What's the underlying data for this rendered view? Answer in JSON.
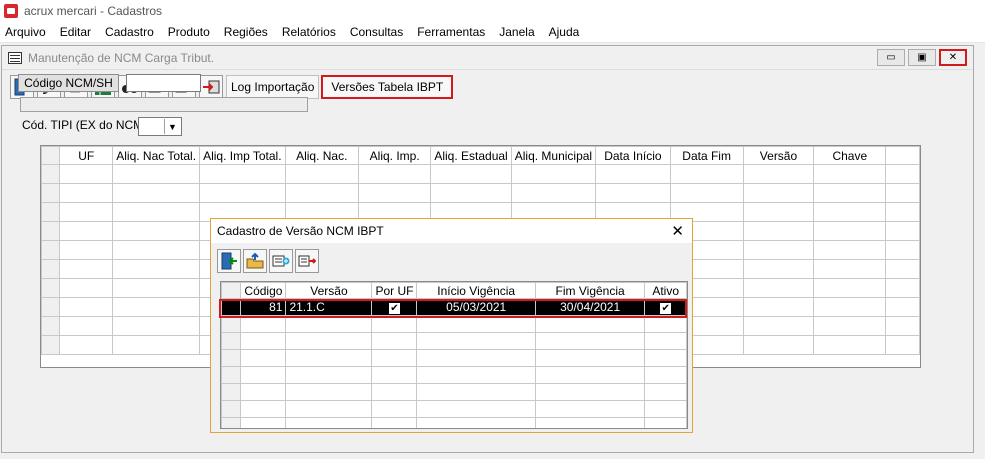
{
  "app": {
    "title": "acrux mercari - Cadastros"
  },
  "menu": [
    "Arquivo",
    "Editar",
    "Cadastro",
    "Produto",
    "Regiões",
    "Relatórios",
    "Consultas",
    "Ferramentas",
    "Janela",
    "Ajuda"
  ],
  "window": {
    "title": "Manutenção de NCM Carga Tribut.",
    "controls": {
      "minimize": "▭",
      "restore": "▣",
      "close": "✕"
    }
  },
  "toolbar": {
    "log_label": "Log Importação",
    "versions_label": "Versões Tabela IBPT"
  },
  "form": {
    "ncm_button": "Código NCM/SH",
    "ncm_value": "",
    "tipi_label": "Cód. TIPI (EX do NCM)",
    "tipi_value": ""
  },
  "main_grid": {
    "columns": [
      "UF",
      "Aliq. Nac Total.",
      "Aliq. Imp Total.",
      "Aliq. Nac.",
      "Aliq. Imp.",
      "Aliq. Estadual",
      "Aliq. Municipal",
      "Data Início",
      "Data Fim",
      "Versão",
      "Chave"
    ]
  },
  "dialog": {
    "title": "Cadastro de Versão NCM IBPT",
    "close": "✕",
    "columns": [
      "Código",
      "Versão",
      "Por UF",
      "Início Vigência",
      "Fim Vigência",
      "Ativo"
    ],
    "rows": [
      {
        "codigo": "81",
        "versao": "21.1.C",
        "por_uf": true,
        "inicio": "05/03/2021",
        "fim": "30/04/2021",
        "ativo": true
      }
    ]
  }
}
